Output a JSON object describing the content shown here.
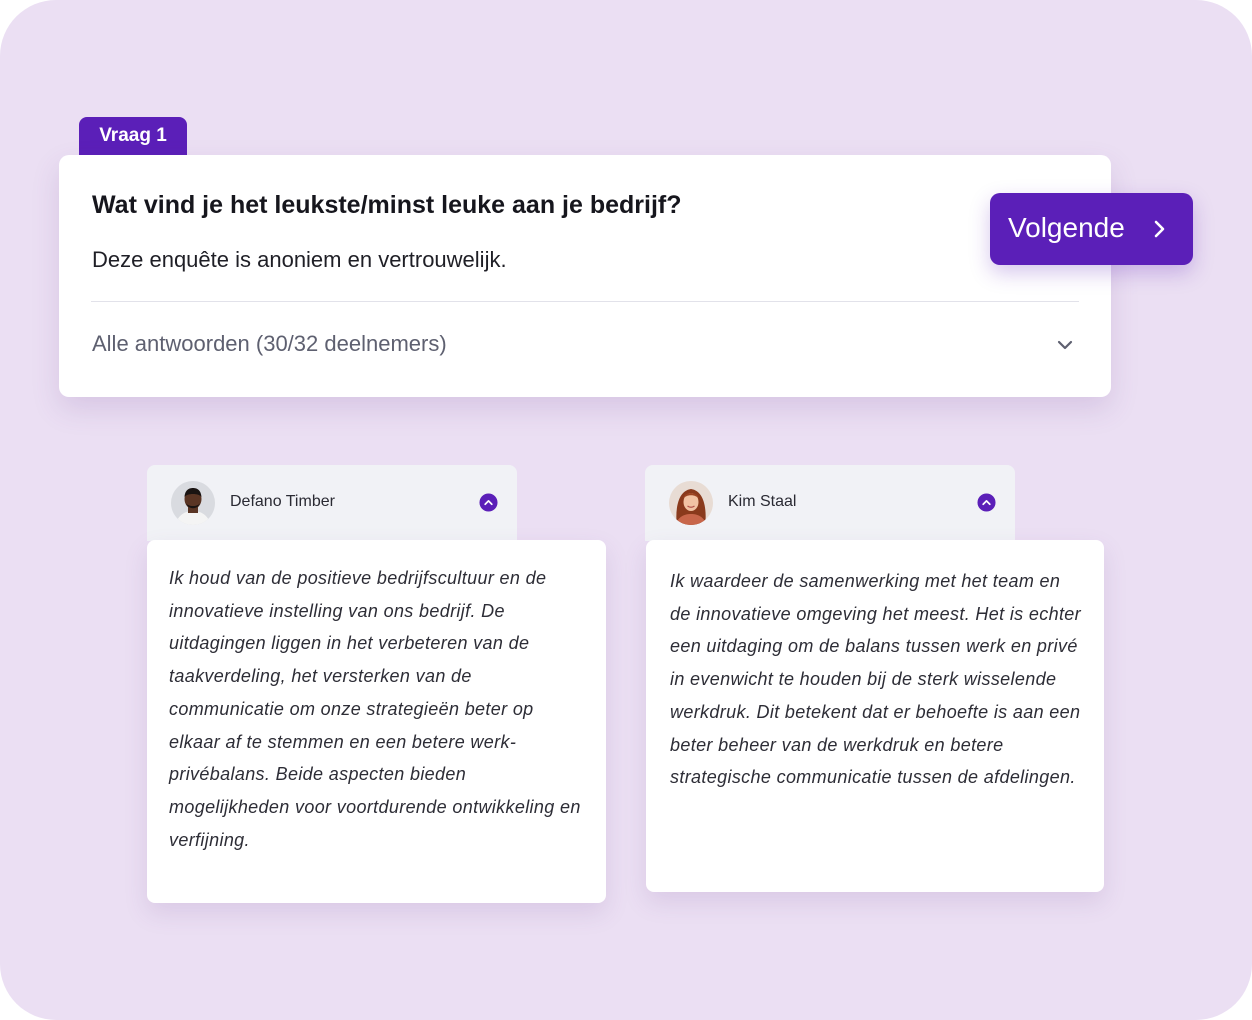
{
  "question": {
    "tag": "Vraag 1",
    "title": "Wat vind je het leukste/minst leuke aan je bedrijf?",
    "subtitle": "Deze enquête is anoniem en vertrouwelijk.",
    "answers_label": "Alle antwoorden (30/32 deelnemers)",
    "next_label": "Volgende"
  },
  "responses": [
    {
      "name": "Defano Timber",
      "text": "Ik houd van de positieve bedrijfscultuur en de innovatieve instelling van ons bedrijf. De uitdagingen liggen in het verbeteren van de taakverdeling, het versterken van de communicatie om onze strategieën beter op elkaar af te stemmen en een betere werk-privébalans. Beide aspecten bieden mogelijkheden voor voortdurende ontwikkeling en verfijning."
    },
    {
      "name": "Kim Staal",
      "text": "Ik waardeer de samenwerking met het team en de innovatieve omgeving het meest. Het is echter een uitdaging om de balans tussen werk en privé in evenwicht te houden bij de sterk wisselende werkdruk. Dit betekent dat er behoefte is aan een beter beheer van de werkdruk en betere strategische communicatie tussen de afdelingen."
    }
  ],
  "icons": {
    "answers_toggle": "chevron-down-icon",
    "next": "chevron-right-icon",
    "response_toggle": "chevron-up-circle-icon"
  },
  "colors": {
    "background": "#ebdff3",
    "accent": "#5b1fb8",
    "card": "#ffffff",
    "response_header": "#f1f2f6"
  }
}
